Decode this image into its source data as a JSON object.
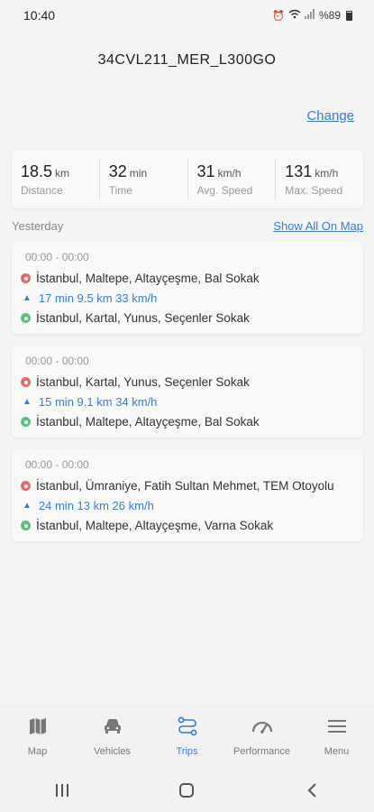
{
  "status_bar": {
    "time": "10:40",
    "battery_text": "%89"
  },
  "header": {
    "title": "34CVL211_MER_L300GO"
  },
  "change_label": "Change",
  "summary": [
    {
      "value": "18.5",
      "unit": "km",
      "label": "Distance"
    },
    {
      "value": "32",
      "unit": "min",
      "label": "Time"
    },
    {
      "value": "31",
      "unit": "km/h",
      "label": "Avg. Speed"
    },
    {
      "value": "131",
      "unit": "km/h",
      "label": "Max. Speed"
    }
  ],
  "section": {
    "title": "Yesterday",
    "show_all_label": "Show All On Map"
  },
  "trips": [
    {
      "time": "00:00 - 00:00",
      "from": "İstanbul, Maltepe, Altayçeşme, Bal Sokak",
      "meta": "17 min 9.5 km 33 km/h",
      "to": "İstanbul, Kartal, Yunus, Seçenler Sokak"
    },
    {
      "time": "00:00 - 00:00",
      "from": "İstanbul, Kartal, Yunus, Seçenler Sokak",
      "meta": "15 min 9.1 km 34 km/h",
      "to": "İstanbul, Maltepe, Altayçeşme, Bal Sokak"
    },
    {
      "time": "00:00 - 00:00",
      "from": "İstanbul, Ümraniye, Fatih Sultan Mehmet, TEM Otoyolu",
      "meta": "24 min 13 km 26 km/h",
      "to": "İstanbul, Maltepe, Altayçeşme, Varna Sokak"
    }
  ],
  "nav": [
    {
      "label": "Map",
      "icon": "map-icon",
      "active": false
    },
    {
      "label": "Vehicles",
      "icon": "car-icon",
      "active": false
    },
    {
      "label": "Trips",
      "icon": "route-icon",
      "active": true
    },
    {
      "label": "Performance",
      "icon": "speedometer-icon",
      "active": false
    },
    {
      "label": "Menu",
      "icon": "menu-icon",
      "active": false
    }
  ],
  "colors": {
    "accent": "#3a7bd5",
    "start_pin": "#e26b6b",
    "end_pin": "#57c27b",
    "inactive_icon": "#777777"
  }
}
